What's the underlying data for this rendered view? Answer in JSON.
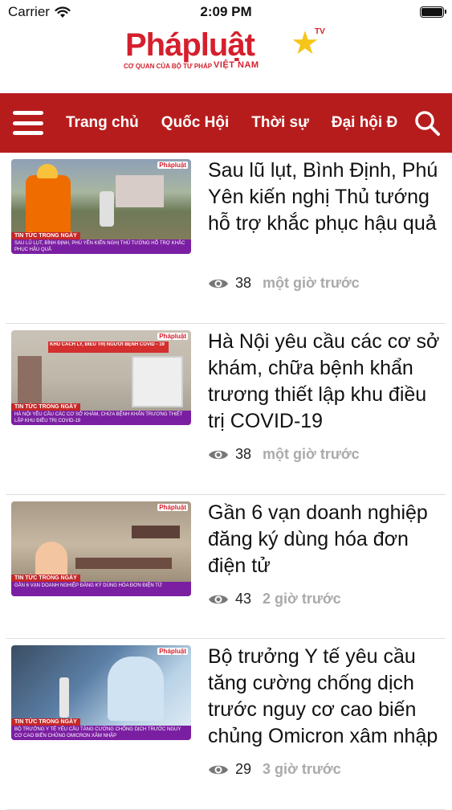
{
  "status": {
    "carrier": "Carrier",
    "time": "2:09 PM"
  },
  "brand": {
    "name": "Phápluật",
    "tv": "TV",
    "tagline": "CƠ QUAN CỦA BỘ TƯ PHÁP",
    "country": "VIỆT NAM"
  },
  "nav": {
    "items": [
      "Trang chủ",
      "Quốc Hội",
      "Thời sự",
      "Đại hội Đ"
    ]
  },
  "articles": [
    {
      "title": "Sau lũ lụt, Bình Định, Phú Yên kiến nghị Thủ tướng hỗ trợ khắc phục hậu quả",
      "views": "38",
      "time": "một giờ trước",
      "thumb_tag": "TIN TỨC TRONG NGÀY",
      "thumb_caption": "SAU LŨ LỤT, BÌNH ĐỊNH, PHÚ YÊN KIẾN NGHỊ THỦ TƯỚNG HỖ TRỢ KHẮC PHỤC HẬU QUẢ",
      "thumb_logo": "Phápluật"
    },
    {
      "title": "Hà Nội yêu cầu các cơ sở khám, chữa bệnh khẩn trương thiết lập khu điều trị COVID-19",
      "views": "38",
      "time": "một giờ trước",
      "thumb_tag": "TIN TỨC TRONG NGÀY",
      "thumb_caption": "HÀ NỘI YÊU CẦU CÁC CƠ SỞ KHÁM, CHỪA BỆNH KHẨN TRƯƠNG THIẾT LẬP KHU ĐIỀU TRỊ COVID-19",
      "thumb_sign": "KHU CÁCH LY, ĐIỀU TRỊ NGƯỜI BỆNH COVID - 19",
      "thumb_logo": "Phápluật"
    },
    {
      "title": "Gần 6 vạn doanh nghiệp đăng ký dùng hóa đơn điện tử",
      "views": "43",
      "time": "2 giờ trước",
      "thumb_tag": "TIN TỨC TRONG NGÀY",
      "thumb_caption": "GẦN 6 VẠN DOANH NGHIỆP ĐĂNG KÝ DÙNG HÓA ĐƠN ĐIỆN TỬ",
      "thumb_logo": "Phápluật"
    },
    {
      "title": "Bộ trưởng Y tế yêu cầu tăng cường chống dịch trước nguy cơ cao biến chủng Omicron xâm nhập",
      "views": "29",
      "time": "3 giờ trước",
      "thumb_tag": "TIN TỨC TRONG NGÀY",
      "thumb_caption": "BỘ TRƯỞNG Y TẾ YÊU CẦU TĂNG CƯỜNG CHỐNG DỊCH TRƯỚC NGUY CƠ CAO BIẾN CHỦNG OMICRON XÂM NHẬP",
      "thumb_logo": "Phápluật"
    }
  ],
  "colors": {
    "brand_red": "#b71c1c",
    "logo_red": "#d51f2d",
    "star": "#f5c518"
  }
}
